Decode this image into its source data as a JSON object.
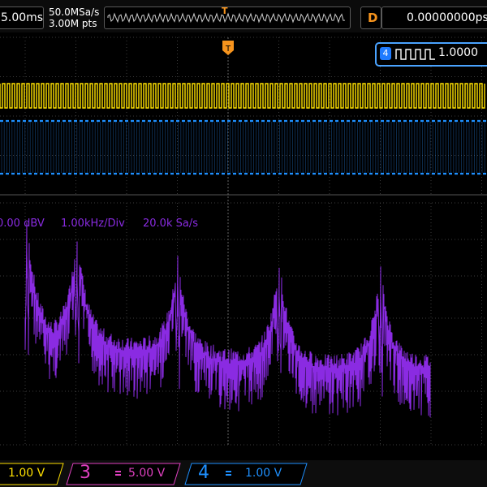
{
  "topbar": {
    "timebase": "5.00ms",
    "sample_rate": "50.0MSa/s",
    "memory_depth": "3.00M pts",
    "trigger_marker": "T",
    "delay_label": "D",
    "delay_value": "0.00000000ps"
  },
  "trigger": {
    "source_channel": "4",
    "level": "1.0000"
  },
  "fft": {
    "ref_level": "0.00 dBV",
    "scale": "1.00kHz/Div",
    "sample_rate": "20.0k Sa/s"
  },
  "channels": [
    {
      "number": "",
      "scale": "1.00 V",
      "color": "#ffe100"
    },
    {
      "number": "3",
      "scale": "5.00 V",
      "color": "#e040c0"
    },
    {
      "number": "4",
      "scale": "1.00 V",
      "color": "#1e90ff"
    }
  ],
  "colors": {
    "ch1": "#ffe100",
    "ch4": "#1e90ff",
    "math": "#8a2be2",
    "trigger": "#f7941d",
    "grid": "#3a3a3a"
  }
}
